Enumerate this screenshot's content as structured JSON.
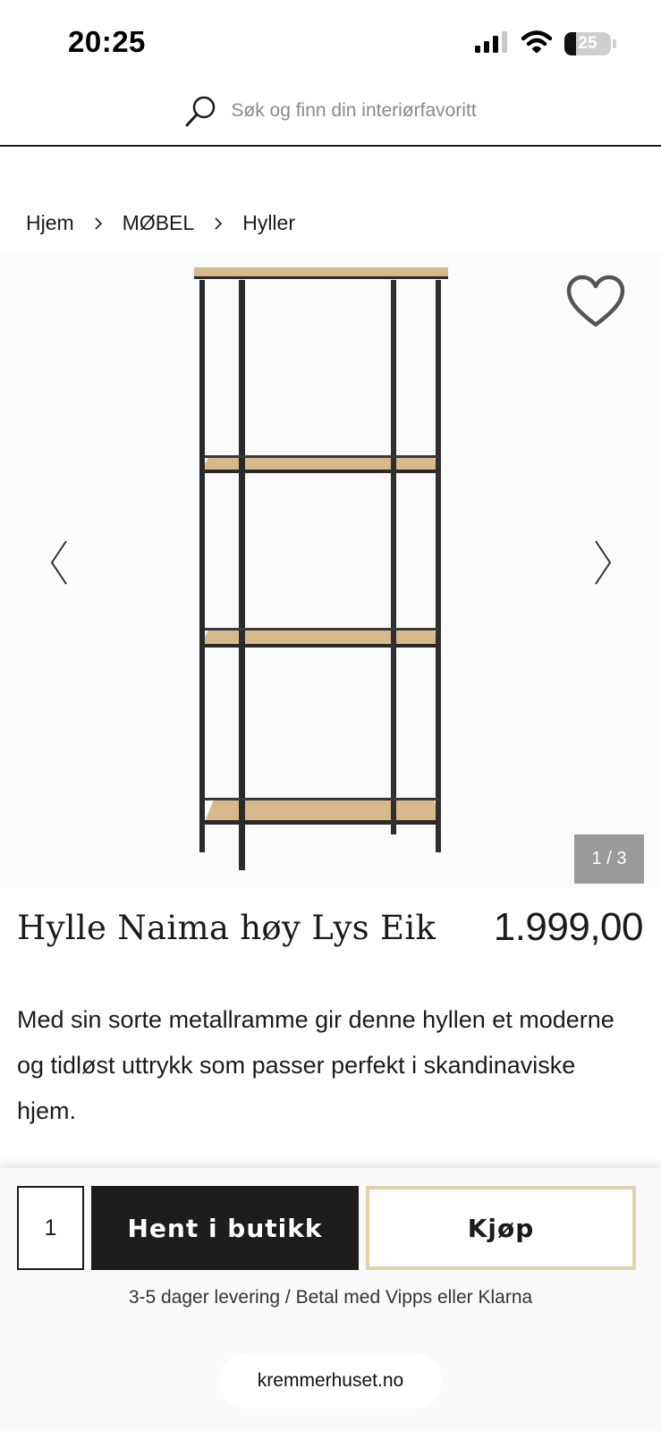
{
  "status_bar": {
    "time": "20:25",
    "battery_level": "25",
    "battery_fraction": 0.25,
    "icons": [
      "signal-icon",
      "wifi-icon",
      "battery-icon"
    ]
  },
  "search": {
    "placeholder": "Søk og finn din interiørfavoritt",
    "icon": "search-icon"
  },
  "breadcrumb": [
    "Hjem",
    "MØBEL",
    "Hyller"
  ],
  "gallery": {
    "counter": "1 / 3",
    "current": 1,
    "total": 3,
    "icons": [
      "heart-icon",
      "chevron-left-icon",
      "chevron-right-icon"
    ]
  },
  "product": {
    "title": "Hylle Naima høy Lys Eik",
    "price": "1.999,00",
    "description": "Med sin sorte metallramme gir denne hyllen et moderne og tidløst uttrykk som passer perfekt i skandinaviske hjem."
  },
  "purchase": {
    "quantity": "1",
    "pickup_label": "Hent i butikk",
    "buy_label": "Kjøp",
    "delivery_note": "3-5 dager levering / Betal med Vipps eller Klarna"
  },
  "browser": {
    "url": "kremmerhuset.no"
  },
  "colors": {
    "primary_dark": "#1d1d1b",
    "accent_gold": "#e2d2ab",
    "counter_bg": "#9a9a9a",
    "oak": "#d7b98c"
  }
}
